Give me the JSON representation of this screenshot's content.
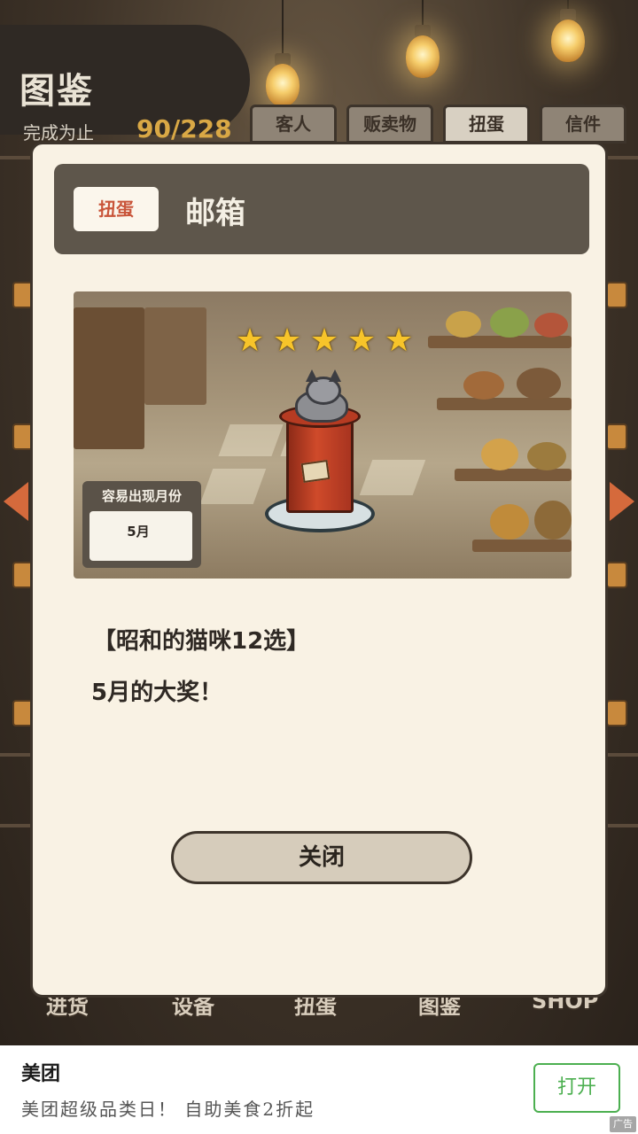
{
  "header": {
    "title": "图鉴",
    "progress_label": "完成为止",
    "progress_count": "90/228"
  },
  "top_tabs": [
    {
      "label": "客人",
      "active": false
    },
    {
      "label": "贩卖物",
      "active": false
    },
    {
      "label": "扭蛋",
      "active": true
    },
    {
      "label": "信件",
      "active": false
    }
  ],
  "bottom_nav": [
    "进货",
    "设备",
    "扭蛋",
    "图鉴",
    "SHOP"
  ],
  "modal": {
    "category_tag": "扭蛋",
    "title": "邮箱",
    "rarity_stars": 5,
    "star_glyph": "★",
    "months_label": "容易出现月份",
    "months_value": "5月",
    "description_line1": "【昭和的猫咪12选】",
    "description_line2": "5月的大奖！",
    "close_label": "关闭"
  },
  "ad": {
    "brand": "美团",
    "text": "美团超级品类日！ 自助美食2折起",
    "open_label": "打开",
    "badge": "广告"
  },
  "colors": {
    "accent_tag": "#c9553a",
    "star": "#f7c42a",
    "progress_count": "#d9a845",
    "ad_button": "#4caf50"
  }
}
